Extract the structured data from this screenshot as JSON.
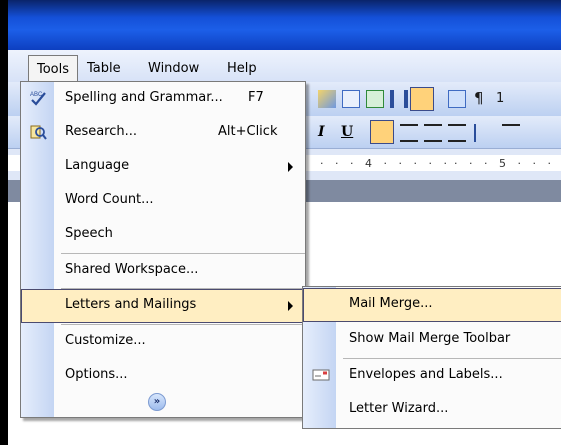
{
  "menubar": {
    "tools": "Tools",
    "table": "Table",
    "window": "Window",
    "help": "Help"
  },
  "toolbar": {
    "pilcrow": "¶",
    "partial_zoom": "1",
    "italic": "I",
    "underline": "U"
  },
  "ruler": {
    "mark4": "· · · 4 · · · · ·",
    "mark5": "· · · 5 · · ·"
  },
  "tools_menu": {
    "items": [
      {
        "label": "Spelling and Grammar...",
        "shortcut": "F7",
        "icon": "spelling-icon"
      },
      {
        "label": "Research...",
        "shortcut": "Alt+Click",
        "icon": "research-icon"
      },
      {
        "label": "Language",
        "submenu": true
      },
      {
        "label": "Word Count..."
      },
      {
        "label": "Speech"
      },
      {
        "label": "Shared Workspace..."
      },
      {
        "label": "Letters and Mailings",
        "submenu": true,
        "highlighted": true
      },
      {
        "label": "Customize..."
      },
      {
        "label": "Options..."
      }
    ],
    "expand_icon": "double-chevron-down-icon"
  },
  "letters_submenu": {
    "items": [
      {
        "label": "Mail Merge...",
        "highlighted": true
      },
      {
        "label": "Show Mail Merge Toolbar"
      },
      {
        "label": "Envelopes and Labels...",
        "icon": "envelope-icon"
      },
      {
        "label": "Letter Wizard..."
      }
    ]
  },
  "colors": {
    "title_blue": "#1c5fe8",
    "menu_highlight": "#ffeec2",
    "highlight_border": "#4b4b6f",
    "gutter": "#c4d5f3"
  }
}
